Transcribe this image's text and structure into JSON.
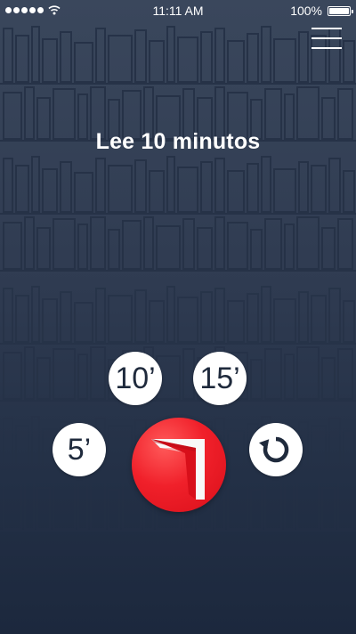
{
  "status_bar": {
    "time": "11:11 AM",
    "battery": "100%"
  },
  "header": {
    "menu_icon": "hamburger-menu-icon"
  },
  "main": {
    "title": "Lee 10 minutos"
  },
  "timer_options": {
    "ten": "10’",
    "fifteen": "15’",
    "five": "5’",
    "reset_icon": "reset-icon"
  },
  "start_button": {
    "icon": "book-logo-icon"
  },
  "colors": {
    "background": "#2f3b51",
    "accent": "#e8131f",
    "button": "#ffffff"
  }
}
